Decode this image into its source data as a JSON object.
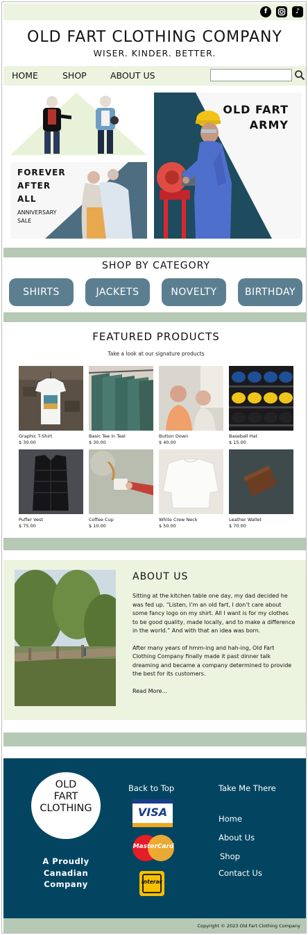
{
  "social": {
    "icons": [
      "facebook-icon",
      "instagram-icon",
      "tiktok-icon"
    ]
  },
  "header": {
    "brand": "OLD FART CLOTHING COMPANY",
    "tagline": "WISER. KINDER. BETTER."
  },
  "nav": {
    "items": [
      "HOME",
      "SHOP",
      "ABOUT US"
    ],
    "search_placeholder": "",
    "search_value": ""
  },
  "hero": {
    "forever": [
      "FOREVER",
      "AFTER",
      "ALL"
    ],
    "anniversary": [
      "ANNIVERSARY",
      "SALE"
    ],
    "army": [
      "OLD FART",
      "ARMY"
    ]
  },
  "categories": {
    "title": "SHOP BY CATEGORY",
    "items": [
      "SHIRTS",
      "JACKETS",
      "NOVELTY",
      "BIRTHDAY"
    ]
  },
  "featured": {
    "title": "FEATURED PRODUCTS",
    "subtitle": "Take a look at our signature products",
    "products": [
      {
        "name": "Graphic T-Shirt",
        "price": "$ 30.00"
      },
      {
        "name": "Basic Tee in Teal",
        "price": "$ 30.00"
      },
      {
        "name": "Button Down",
        "price": "$ 40.00"
      },
      {
        "name": "Baseball Hat",
        "price": "$ 15.00"
      },
      {
        "name": "Puffer Vest",
        "price": "$ 75.00"
      },
      {
        "name": "Coffee Cup",
        "price": "$ 10.00"
      },
      {
        "name": "White Crew Neck",
        "price": "$ 50.00"
      },
      {
        "name": "Leather Wallet",
        "price": "$ 70.00"
      }
    ]
  },
  "about": {
    "title": "ABOUT US",
    "p1": "Sitting at the kitchen table one day, my dad decided he was fed up.  “Listen, I’m an old fart, I don’t care about some fancy logo on my shirt.  All I want is for my clothes to be good quality, made locally, and to make a difference in the world.”  And with that an idea was born.",
    "p2": "After many years of hmm-ing and hah-ing, Old Fart Clothing Company finally made it past dinner talk dreaming and became a company determined to provide the best for its customers.",
    "read_more": "Read More..."
  },
  "footer": {
    "logo": [
      "OLD",
      "FART",
      "CLOTHING"
    ],
    "canadian": [
      "A Proudly",
      "Canadian",
      "Company"
    ],
    "back_to_top": "Back to Top",
    "payments": {
      "visa": "VISA",
      "mastercard": "MasterCard",
      "interac": "Interac"
    },
    "take_me_there": "Take Me There",
    "links": [
      "Home",
      "About Us",
      "Shop",
      "Contact Us"
    ],
    "copyright": "Copyright © 2023 Old Fart Clothing Company"
  },
  "colors": {
    "accent": "#5b7f91",
    "footer": "#034561",
    "light_green": "#ecf3df",
    "sage": "#b5c9b4"
  }
}
